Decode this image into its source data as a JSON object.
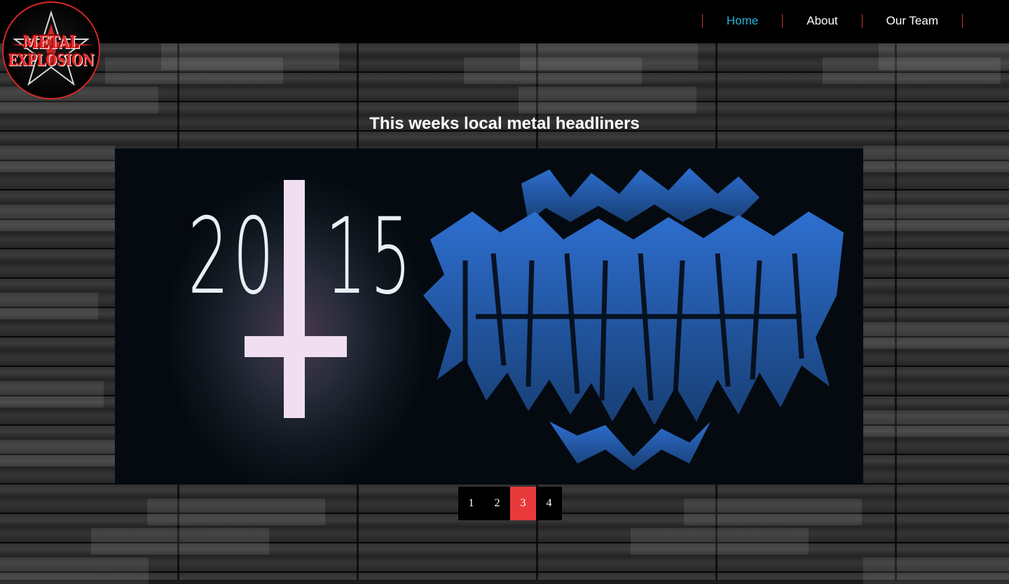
{
  "site": {
    "logo_text_line1": "METAL",
    "logo_text_line2": "EXPLOSION"
  },
  "nav": {
    "items": [
      {
        "label": "Home",
        "active": true
      },
      {
        "label": "About",
        "active": false
      },
      {
        "label": "Our Team",
        "active": false
      }
    ]
  },
  "main": {
    "headline": "This weeks local metal headliners",
    "slide": {
      "year_left": "20",
      "year_right": "15"
    },
    "pagination": {
      "pages": [
        "1",
        "2",
        "3",
        "4"
      ],
      "current": "3"
    }
  },
  "colors": {
    "accent": "#e83a3a",
    "nav_active": "#26b3d9",
    "header_bg": "#000000",
    "band_logo": "#1d5fb8"
  }
}
